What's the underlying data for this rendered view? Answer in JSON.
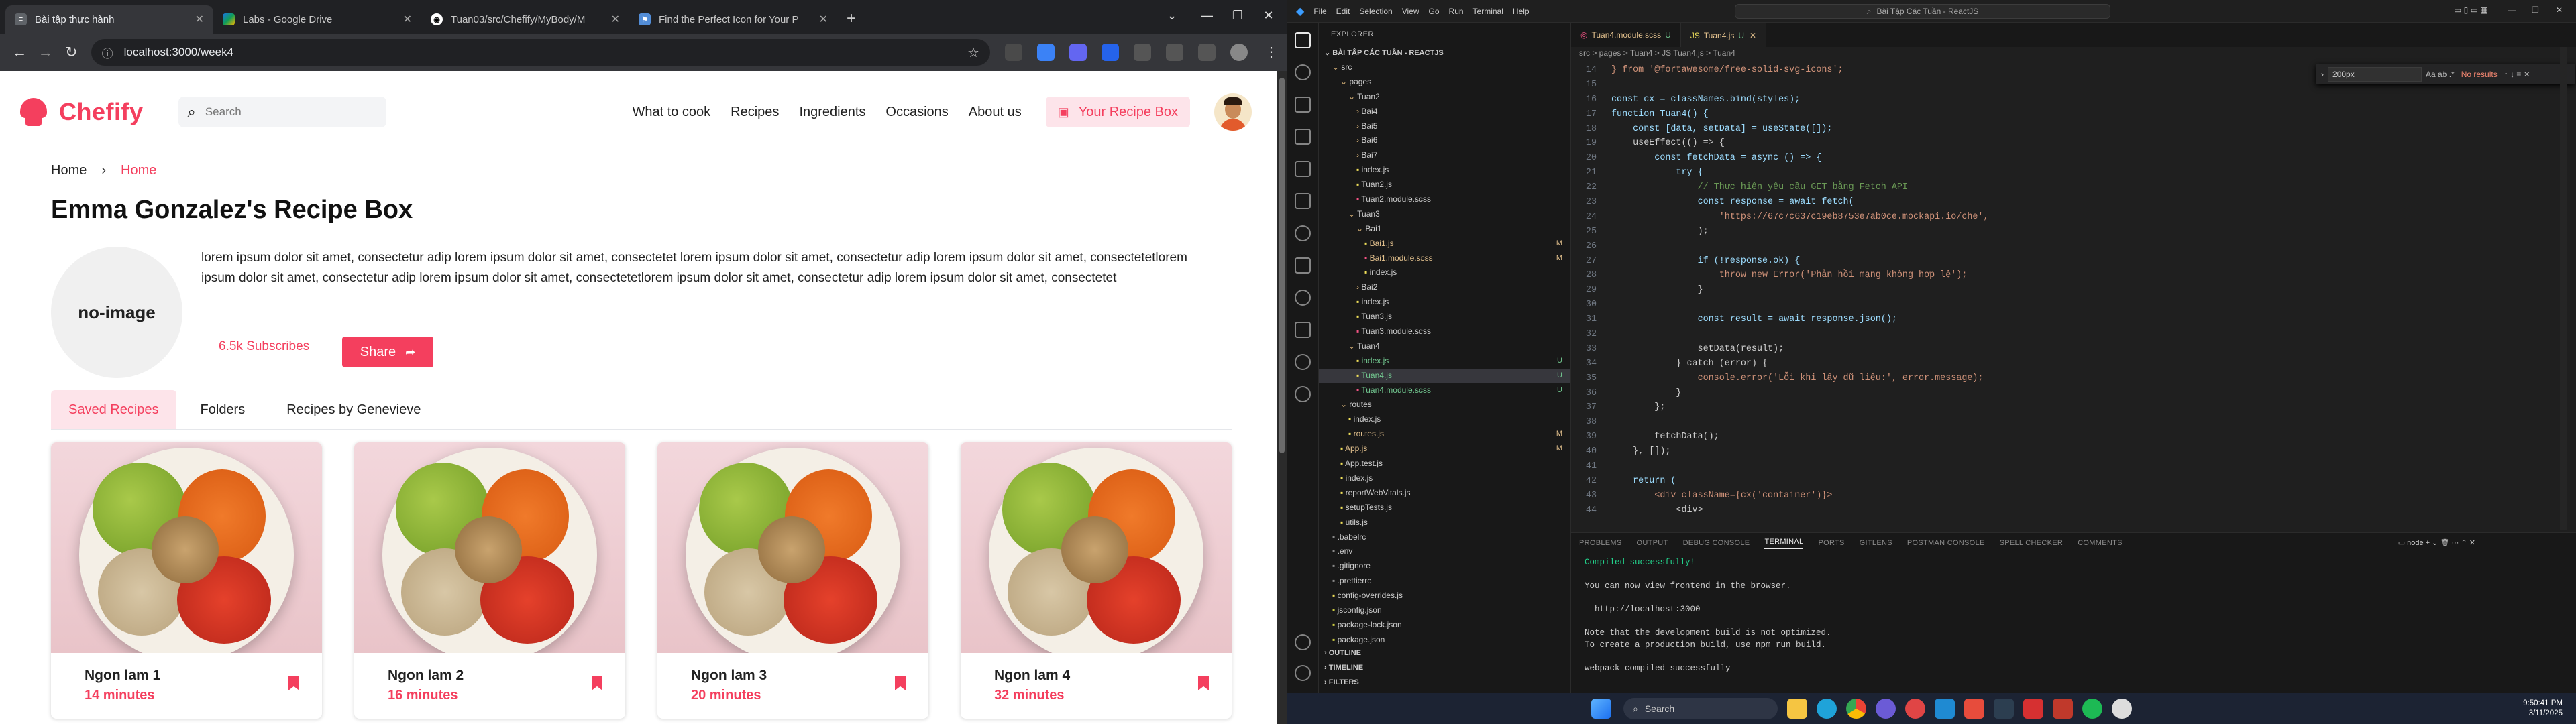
{
  "browser": {
    "tabs": [
      {
        "title": "Bài tập thực hành",
        "active": true,
        "color": "#5f6368"
      },
      {
        "title": "Labs - Google Drive",
        "active": false,
        "color": "#1a73e8"
      },
      {
        "title": "Tuan03/src/Chefify/MyBody/M",
        "active": false,
        "color": "#24292f"
      },
      {
        "title": "Find the Perfect Icon for Your P",
        "active": false,
        "color": "#528dd7"
      }
    ],
    "new_tab": "+",
    "url": "localhost:3000/week4"
  },
  "app": {
    "brand": "Chefify",
    "search_placeholder": "Search",
    "nav": [
      "What to cook",
      "Recipes",
      "Ingredients",
      "Occasions",
      "About us"
    ],
    "recipe_box_button": "Your Recipe Box",
    "breadcrumb": [
      "Home",
      "Home"
    ],
    "title": "Emma Gonzalez's Recipe Box",
    "no_image": "no-image",
    "bio": "lorem ipsum dolor sit amet, consectetur adip lorem ipsum dolor sit amet, consectetet lorem ipsum dolor sit amet, consectetur adip lorem ipsum dolor sit amet, consectetetlorem ipsum dolor sit amet, consectetur adip lorem ipsum dolor sit amet, consectetetlorem ipsum dolor sit amet, consectetur adip lorem ipsum dolor sit amet, consectetet",
    "subscribes": "6.5k Subscribes",
    "share": "Share",
    "tabs": [
      "Saved Recipes",
      "Folders",
      "Recipes by Genevieve"
    ],
    "cards": [
      {
        "name": "Ngon lam 1",
        "time": "14 minutes"
      },
      {
        "name": "Ngon lam 2",
        "time": "16 minutes"
      },
      {
        "name": "Ngon lam 3",
        "time": "20 minutes"
      },
      {
        "name": "Ngon lam 4",
        "time": "32 minutes"
      }
    ],
    "colors": {
      "accent": "#f43f5e",
      "accent_soft": "#fde4ea"
    }
  },
  "vscode": {
    "menu": [
      "File",
      "Edit",
      "Selection",
      "View",
      "Go",
      "Run",
      "Terminal",
      "Help"
    ],
    "command_center": "Bài Tập Các Tuần - ReactJS",
    "explorer_title": "EXPLORER",
    "project": "BÀI TẬP CÁC TUẦN - REACTJS",
    "tree": [
      {
        "name": "src",
        "indent": 1,
        "type": "folder-open",
        "badge": ""
      },
      {
        "name": "pages",
        "indent": 2,
        "type": "folder-open",
        "badge": ""
      },
      {
        "name": "Tuan2",
        "indent": 3,
        "type": "folder-open",
        "badge": ""
      },
      {
        "name": "Bai4",
        "indent": 4,
        "type": "folder",
        "badge": ""
      },
      {
        "name": "Bai5",
        "indent": 4,
        "type": "folder",
        "badge": ""
      },
      {
        "name": "Bai6",
        "indent": 4,
        "type": "folder",
        "badge": ""
      },
      {
        "name": "Bai7",
        "indent": 4,
        "type": "folder",
        "badge": ""
      },
      {
        "name": "index.js",
        "indent": 4,
        "type": "js",
        "badge": ""
      },
      {
        "name": "Tuan2.js",
        "indent": 4,
        "type": "js",
        "badge": ""
      },
      {
        "name": "Tuan2.module.scss",
        "indent": 4,
        "type": "scss",
        "badge": ""
      },
      {
        "name": "Tuan3",
        "indent": 3,
        "type": "folder-open",
        "badge": ""
      },
      {
        "name": "Bai1",
        "indent": 4,
        "type": "folder-open",
        "badge": ""
      },
      {
        "name": "Bai1.js",
        "indent": 5,
        "type": "js",
        "badge": "M"
      },
      {
        "name": "Bai1.module.scss",
        "indent": 5,
        "type": "scss",
        "badge": "M"
      },
      {
        "name": "index.js",
        "indent": 5,
        "type": "js",
        "badge": ""
      },
      {
        "name": "Bai2",
        "indent": 4,
        "type": "folder",
        "badge": ""
      },
      {
        "name": "index.js",
        "indent": 4,
        "type": "js",
        "badge": ""
      },
      {
        "name": "Tuan3.js",
        "indent": 4,
        "type": "js",
        "badge": ""
      },
      {
        "name": "Tuan3.module.scss",
        "indent": 4,
        "type": "scss",
        "badge": ""
      },
      {
        "name": "Tuan4",
        "indent": 3,
        "type": "folder-open",
        "badge": ""
      },
      {
        "name": "index.js",
        "indent": 4,
        "type": "js",
        "badge": "U"
      },
      {
        "name": "Tuan4.js",
        "indent": 4,
        "type": "js",
        "badge": "U"
      },
      {
        "name": "Tuan4.module.scss",
        "indent": 4,
        "type": "scss",
        "badge": "U"
      },
      {
        "name": "routes",
        "indent": 2,
        "type": "folder-open",
        "badge": ""
      },
      {
        "name": "index.js",
        "indent": 3,
        "type": "js",
        "badge": ""
      },
      {
        "name": "routes.js",
        "indent": 3,
        "type": "js",
        "badge": "M"
      },
      {
        "name": "App.js",
        "indent": 2,
        "type": "js",
        "badge": "M"
      },
      {
        "name": "App.test.js",
        "indent": 2,
        "type": "js",
        "badge": ""
      },
      {
        "name": "index.js",
        "indent": 2,
        "type": "js",
        "badge": ""
      },
      {
        "name": "reportWebVitals.js",
        "indent": 2,
        "type": "js",
        "badge": ""
      },
      {
        "name": "setupTests.js",
        "indent": 2,
        "type": "js",
        "badge": ""
      },
      {
        "name": "utils.js",
        "indent": 2,
        "type": "js",
        "badge": ""
      },
      {
        "name": ".babelrc",
        "indent": 1,
        "type": "cfg",
        "badge": ""
      },
      {
        "name": ".env",
        "indent": 1,
        "type": "cfg",
        "badge": ""
      },
      {
        "name": ".gitignore",
        "indent": 1,
        "type": "cfg",
        "badge": ""
      },
      {
        "name": ".prettierrc",
        "indent": 1,
        "type": "cfg",
        "badge": ""
      },
      {
        "name": "config-overrides.js",
        "indent": 1,
        "type": "js",
        "badge": ""
      },
      {
        "name": "jsconfig.json",
        "indent": 1,
        "type": "json",
        "badge": ""
      },
      {
        "name": "package-lock.json",
        "indent": 1,
        "type": "json",
        "badge": ""
      },
      {
        "name": "package.json",
        "indent": 1,
        "type": "json",
        "badge": ""
      }
    ],
    "sections": [
      "OUTLINE",
      "TIMELINE",
      "FILTERS"
    ],
    "editor_tabs": [
      {
        "name": "Tuan4.module.scss",
        "state": "U",
        "active": false
      },
      {
        "name": "Tuan4.js",
        "state": "U",
        "active": true
      }
    ],
    "editor_breadcrumb": "src > pages > Tuan4 > JS Tuan4.js > Tuan4",
    "find_value": "200px",
    "find_result": "No results",
    "code": [
      {
        "n": "14",
        "t": "} from '@fortawesome/free-solid-svg-icons';"
      },
      {
        "n": "15",
        "t": ""
      },
      {
        "n": "16",
        "t": "const cx = classNames.bind(styles);"
      },
      {
        "n": "17",
        "t": "function Tuan4() {"
      },
      {
        "n": "18",
        "t": "    const [data, setData] = useState([]);"
      },
      {
        "n": "19",
        "t": "    useEffect(() => {"
      },
      {
        "n": "20",
        "t": "        const fetchData = async () => {"
      },
      {
        "n": "21",
        "t": "            try {"
      },
      {
        "n": "22",
        "t": "                // Thực hiện yêu cầu GET bằng Fetch API"
      },
      {
        "n": "23",
        "t": "                const response = await fetch("
      },
      {
        "n": "24",
        "t": "                    'https://67c7c637c19eb8753e7ab0ce.mockapi.io/che',"
      },
      {
        "n": "25",
        "t": "                );"
      },
      {
        "n": "26",
        "t": ""
      },
      {
        "n": "27",
        "t": "                if (!response.ok) {"
      },
      {
        "n": "28",
        "t": "                    throw new Error('Phản hồi mạng không hợp lệ');"
      },
      {
        "n": "29",
        "t": "                }"
      },
      {
        "n": "30",
        "t": ""
      },
      {
        "n": "31",
        "t": "                const result = await response.json();"
      },
      {
        "n": "32",
        "t": ""
      },
      {
        "n": "33",
        "t": "                setData(result);"
      },
      {
        "n": "34",
        "t": "            } catch (error) {"
      },
      {
        "n": "35",
        "t": "                console.error('Lỗi khi lấy dữ liệu:', error.message);"
      },
      {
        "n": "36",
        "t": "            }"
      },
      {
        "n": "37",
        "t": "        };"
      },
      {
        "n": "38",
        "t": ""
      },
      {
        "n": "39",
        "t": "        fetchData();"
      },
      {
        "n": "40",
        "t": "    }, []);"
      },
      {
        "n": "41",
        "t": ""
      },
      {
        "n": "42",
        "t": "    return ("
      },
      {
        "n": "43",
        "t": "        <div className={cx('container')}>"
      },
      {
        "n": "44",
        "t": "            <div>"
      }
    ],
    "panel_tabs": [
      "PROBLEMS",
      "OUTPUT",
      "DEBUG CONSOLE",
      "TERMINAL",
      "PORTS",
      "GITLENS",
      "POSTMAN CONSOLE",
      "SPELL CHECKER",
      "COMMENTS"
    ],
    "panel_active": "TERMINAL",
    "terminal_shell": "node",
    "terminal": [
      "Compiled successfully!",
      "",
      "You can now view frontend in the browser.",
      "",
      "  http://localhost:3000",
      "",
      "Note that the development build is not optimized.",
      "To create a production build, use npm run build.",
      "",
      "webpack compiled successfully"
    ]
  },
  "taskbar": {
    "search": "Search",
    "time": "9:50:41 PM",
    "date": "3/11/2025"
  }
}
